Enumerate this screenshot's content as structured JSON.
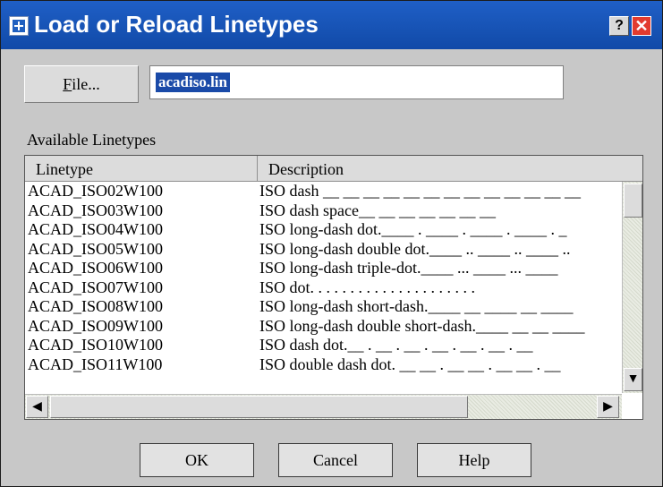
{
  "window": {
    "title": "Load or Reload Linetypes",
    "help_label": "?",
    "close_label": "✕"
  },
  "file": {
    "button_label": "File...",
    "value": "acadiso.lin"
  },
  "list": {
    "label": "Available Linetypes",
    "headers": [
      "Linetype",
      "Description"
    ],
    "rows": [
      {
        "linetype": "ACAD_ISO02W100",
        "description": "ISO dash __ __ __ __ __ __ __ __ __ __ __ __ __"
      },
      {
        "linetype": "ACAD_ISO03W100",
        "description": "ISO dash space__    __    __    __    __    __    __"
      },
      {
        "linetype": "ACAD_ISO04W100",
        "description": "ISO long-dash dot.____ . ____ . ____ . ____ . _"
      },
      {
        "linetype": "ACAD_ISO05W100",
        "description": "ISO long-dash double dot.____ .. ____ .. ____ .."
      },
      {
        "linetype": "ACAD_ISO06W100",
        "description": "ISO long-dash triple-dot.____ ... ____ ... ____"
      },
      {
        "linetype": "ACAD_ISO07W100",
        "description": "ISO dot. . . . . . .  . . . . . . . . . . . . . ."
      },
      {
        "linetype": "ACAD_ISO08W100",
        "description": "ISO long-dash short-dash.____ __ ____ __ ____"
      },
      {
        "linetype": "ACAD_ISO09W100",
        "description": "ISO long-dash double short-dash.____ __ __ ____"
      },
      {
        "linetype": "ACAD_ISO10W100",
        "description": "ISO dash dot.__ . __ . __ . __ . __ . __ . __"
      },
      {
        "linetype": "ACAD_ISO11W100",
        "description": "ISO double dash dot. __ __ . __ __ . __ __ . __"
      }
    ]
  },
  "scroll": {
    "up_arrow": "▲",
    "down_arrow": "▼",
    "left_arrow": "◀",
    "right_arrow": "▶"
  },
  "buttons": {
    "ok": "OK",
    "cancel": "Cancel",
    "help": "Help"
  },
  "colors": {
    "titlebar": "#1656bc",
    "close_button": "#e23b2e",
    "selection": "#1a4aa8",
    "dialog_background": "#c8c8c8"
  }
}
